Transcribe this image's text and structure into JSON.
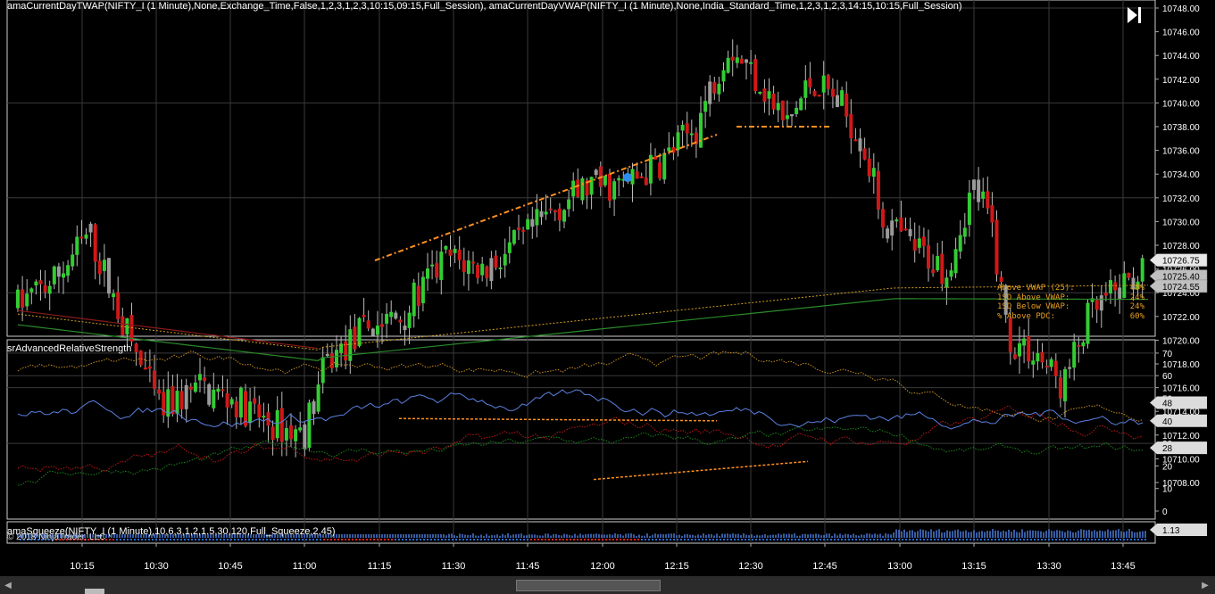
{
  "price_panel": {
    "title": "amaCurrentDayTWAP(NIFTY_I (1 Minute),None,Exchange_Time,False,1,2,3,1,2,3,10:15,09:15,Full_Session), amaCurrentDayVWAP(NIFTY_I (1 Minute),None,India_Standard_Time,1,2,3,1,2,3,14:15,10:15,Full_Session)",
    "y_ticks": [
      "10748.00",
      "10746.00",
      "10744.00",
      "10742.00",
      "10740.00",
      "10738.00",
      "10736.00",
      "10734.00",
      "10732.00",
      "10730.00",
      "10728.00",
      "10726.00",
      "10724.00",
      "10722.00",
      "10720.00",
      "10718.00",
      "10716.00",
      "10714.00",
      "10712.00",
      "10710.00",
      "10708.00"
    ],
    "markers": [
      {
        "label": "10726.75",
        "value": 10726.75,
        "color": "#e8e8e8"
      },
      {
        "label": "10725.40",
        "value": 10725.4,
        "color": "#c0c0c0"
      },
      {
        "label": "10724.55",
        "value": 10724.55,
        "color": "#c0c0c0"
      }
    ],
    "stats": [
      {
        "label": "Above VWAP (25):",
        "value": "48%"
      },
      {
        "label": "1SD Above VWAP:",
        "value": "24%"
      },
      {
        "label": "1SD Below VWAP:",
        "value": "24%"
      },
      {
        "label": "% Above PDC:",
        "value": "60%"
      }
    ]
  },
  "rs_panel": {
    "title": "srAdvancedRelativeStrength",
    "y_ticks": [
      "70",
      "60",
      "50",
      "40",
      "30",
      "20",
      "10",
      "0"
    ],
    "markers": [
      {
        "label": "48",
        "value": 48
      },
      {
        "label": "40",
        "value": 40
      },
      {
        "label": "28",
        "value": 28
      }
    ]
  },
  "squeeze_panel": {
    "title": "amaSqueeze(NIFTY_I (1 Minute),10,6,3,1,2,1.5,30,120,Full_Squeeze,2,45)",
    "marker": "1.13"
  },
  "copyright": "© 2018 NinjaTrader, LLC",
  "x_ticks": [
    "10:15",
    "10:30",
    "10:45",
    "11:00",
    "11:15",
    "11:30",
    "11:45",
    "12:00",
    "12:15",
    "12:30",
    "12:45",
    "13:00",
    "13:15",
    "13:30",
    "13:45"
  ],
  "colors": {
    "up": "#33cc33",
    "down": "#d01818",
    "neutral": "#9a9a9a",
    "twap": "#d4a020",
    "vwap": "#2a8a2a",
    "rs_blue": "#5a80e0",
    "rs_orange": "#c89020",
    "rs_red": "#c01818",
    "rs_green": "#1a8a1a",
    "trend": "#ff9020",
    "dot": "#2d8cf0"
  }
}
